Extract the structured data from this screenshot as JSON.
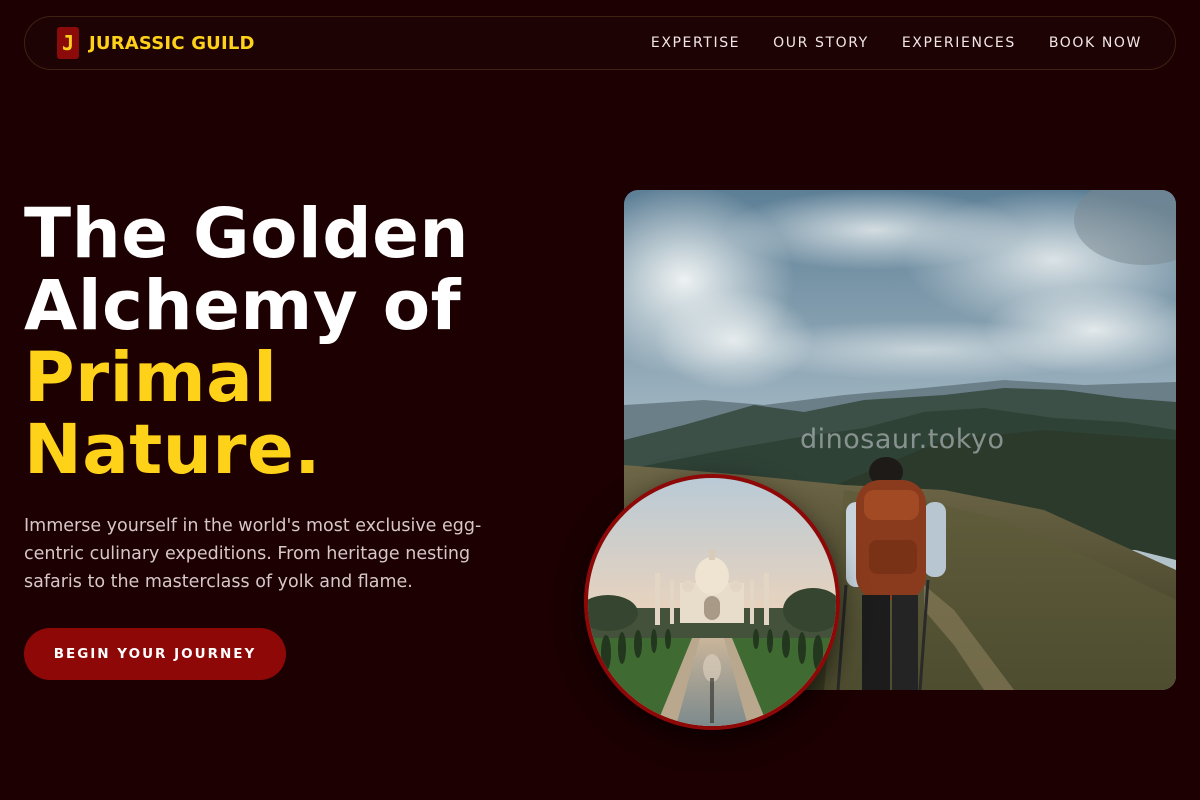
{
  "brand": {
    "mark_letter": "J",
    "name": "JURASSIC GUILD"
  },
  "nav": {
    "links": [
      "EXPERTISE",
      "OUR STORY",
      "EXPERIENCES",
      "BOOK NOW"
    ]
  },
  "hero": {
    "title_lines": [
      "The Golden",
      "Alchemy of",
      "Primal",
      "Nature."
    ],
    "description": "Immerse yourself in the world's most exclusive egg-centric culinary expeditions. From heritage nesting safaris to the masterclass of yolk and flame.",
    "cta_label": "BEGIN YOUR JOURNEY"
  },
  "images": {
    "main_photo_watermark": "dinosaur.tokyo"
  },
  "colors": {
    "background": "#1c0002",
    "accent_gold": "#ffd21a",
    "accent_red": "#8f0808"
  }
}
